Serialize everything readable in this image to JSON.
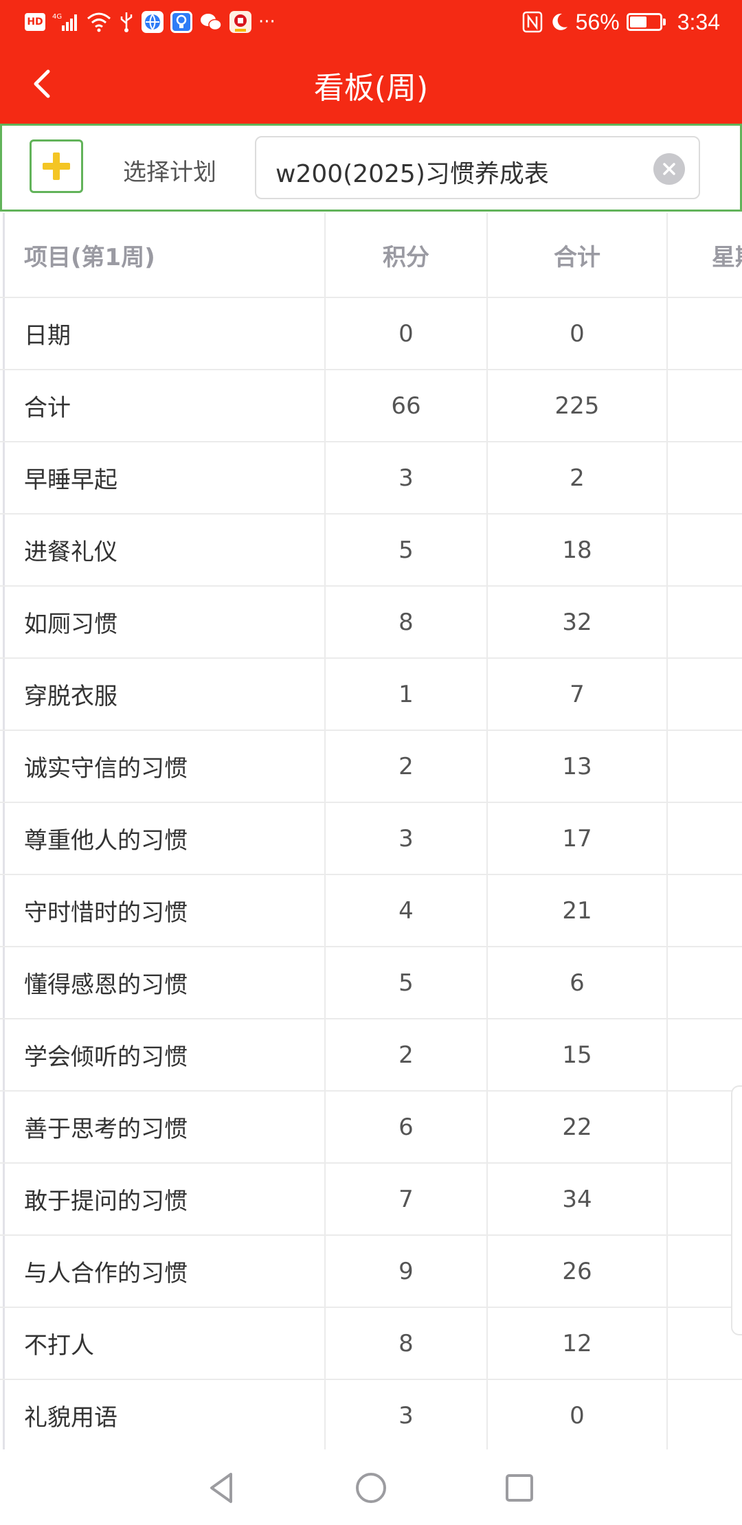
{
  "status_bar": {
    "battery_percent": "56%",
    "battery_level": 0.56,
    "time": "3:34",
    "overflow": "···",
    "icons": [
      "hd-icon",
      "4g-signal-icon",
      "wifi-icon",
      "usb-icon",
      "browser-app-icon",
      "bulb-app-icon",
      "wechat-icon",
      "bank-app-icon",
      "nfc-icon",
      "moon-icon",
      "battery-icon"
    ]
  },
  "titlebar": {
    "title": "看板(周)",
    "back_icon": "chevron-left-icon"
  },
  "plan_selector": {
    "add_icon": "plus-icon",
    "label": "选择计划",
    "value": "w200(2025)习惯养成表",
    "clear_icon": "close-circle-icon"
  },
  "colors": {
    "header_bg": "#f42a14",
    "accent_green": "#62b35a",
    "plus_yellow": "#f4c524"
  },
  "table": {
    "columns": [
      "项目(第1周)",
      "积分",
      "合计",
      "星期"
    ],
    "rows": [
      {
        "name": "日期",
        "score": "0",
        "total": "0"
      },
      {
        "name": "合计",
        "score": "66",
        "total": "225"
      },
      {
        "name": "早睡早起",
        "score": "3",
        "total": "2"
      },
      {
        "name": "进餐礼仪",
        "score": "5",
        "total": "18"
      },
      {
        "name": "如厕习惯",
        "score": "8",
        "total": "32"
      },
      {
        "name": "穿脱衣服",
        "score": "1",
        "total": "7"
      },
      {
        "name": "诚实守信的习惯",
        "score": "2",
        "total": "13"
      },
      {
        "name": "尊重他人的习惯",
        "score": "3",
        "total": "17"
      },
      {
        "name": "守时惜时的习惯",
        "score": "4",
        "total": "21"
      },
      {
        "name": "懂得感恩的习惯",
        "score": "5",
        "total": "6"
      },
      {
        "name": "学会倾听的习惯",
        "score": "2",
        "total": "15"
      },
      {
        "name": "善于思考的习惯",
        "score": "6",
        "total": "22"
      },
      {
        "name": "敢于提问的习惯",
        "score": "7",
        "total": "34"
      },
      {
        "name": "与人合作的习惯",
        "score": "9",
        "total": "26"
      },
      {
        "name": "不打人",
        "score": "8",
        "total": "12"
      },
      {
        "name": "礼貌用语",
        "score": "3",
        "total": "0"
      }
    ]
  },
  "nav_bar": {
    "buttons": [
      "back-triangle-icon",
      "home-circle-icon",
      "recents-square-icon"
    ]
  }
}
